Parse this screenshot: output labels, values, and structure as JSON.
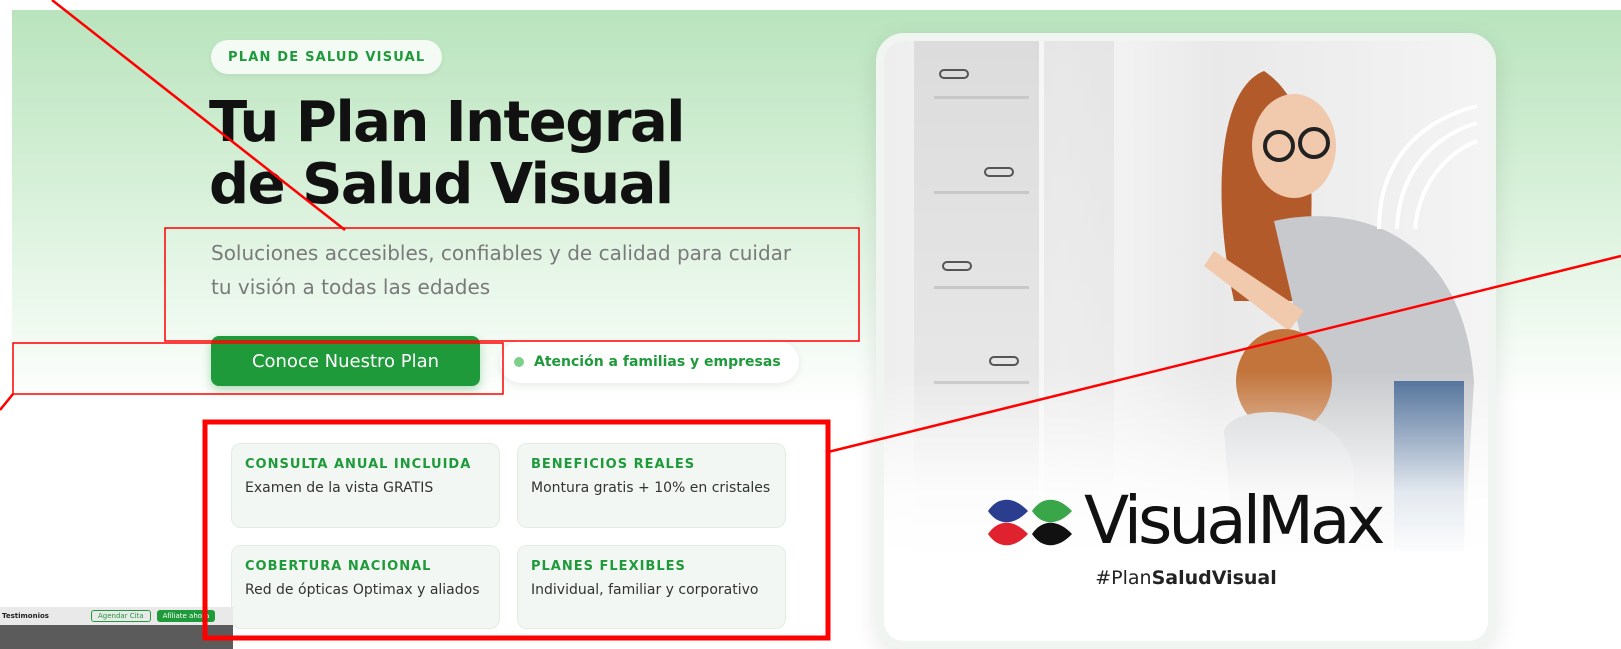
{
  "hero": {
    "badge": "PLAN DE SALUD VISUAL",
    "title_line1": "Tu Plan Integral",
    "title_line2": "de Salud Visual",
    "subtitle_line1": "Soluciones accesibles, confiables y de calidad para cuidar",
    "subtitle_line2": "tu visión a todas las edades",
    "cta_label": "Conoce Nuestro Plan",
    "pill_label": "Atención a familias y empresas"
  },
  "features": [
    {
      "heading": "CONSULTA ANUAL INCLUIDA",
      "description": "Examen de la vista GRATIS"
    },
    {
      "heading": "BENEFICIOS REALES",
      "description": "Montura gratis + 10% en cristales"
    },
    {
      "heading": "COBERTURA NACIONAL",
      "description": "Red de ópticas Optimax y aliados"
    },
    {
      "heading": "PLANES FLEXIBLES",
      "description": "Individual, familiar y corporativo"
    }
  ],
  "card": {
    "brand": "VisualMax",
    "hashtag_prefix": "#Plan",
    "hashtag_bold": "SaludVisual"
  },
  "thumbnail": {
    "nav_label": "Testimonios",
    "outline_button": "Agendar Cita",
    "filled_button": "Afíliate ahora"
  },
  "colors": {
    "accent": "#1f9a3b",
    "annotation": "#ff0000",
    "logo_blue": "#2a3d8f",
    "logo_green": "#3aa64a",
    "logo_red": "#e0222e",
    "logo_black": "#111111"
  }
}
